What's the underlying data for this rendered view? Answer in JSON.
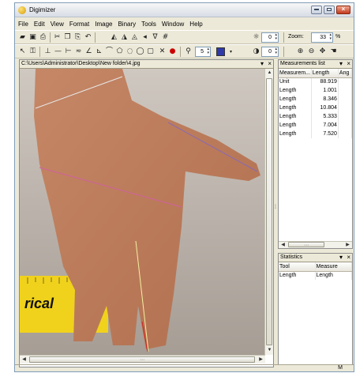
{
  "window": {
    "title": "Digimizer"
  },
  "menubar": {
    "items": [
      "File",
      "Edit",
      "View",
      "Format",
      "Image",
      "Binary",
      "Tools",
      "Window",
      "Help"
    ]
  },
  "toolbar": {
    "spin1_value": "0",
    "spin2_value": "0",
    "zoom_label": "Zoom:",
    "zoom_value": "33",
    "zoom_unit": "%",
    "line_width_value": "5",
    "line_color": "#2f3aa8"
  },
  "image_panel": {
    "path": "C:\\Users\\Administrator\\Desktop\\New folder\\4.jpg",
    "pin_icon": "pin-icon",
    "close_icon": "close-icon",
    "ruler_text": "rical"
  },
  "measurements": {
    "title": "Measurements list",
    "columns": [
      "Measurem...",
      "Length",
      "Ang"
    ],
    "rows": [
      {
        "name": "Unit",
        "value": "88.919"
      },
      {
        "name": "Length",
        "value": "1.001"
      },
      {
        "name": "Length",
        "value": "8.346"
      },
      {
        "name": "Length",
        "value": "10.804"
      },
      {
        "name": "Length",
        "value": "5.333"
      },
      {
        "name": "Length",
        "value": "7.004"
      },
      {
        "name": "Length",
        "value": "7.520"
      }
    ]
  },
  "statistics": {
    "title": "Statistics",
    "columns": [
      "Tool",
      "Measure"
    ],
    "rows": [
      {
        "tool": "Length",
        "measure": "Length"
      }
    ]
  },
  "statusbar": {
    "indicator": "M"
  }
}
